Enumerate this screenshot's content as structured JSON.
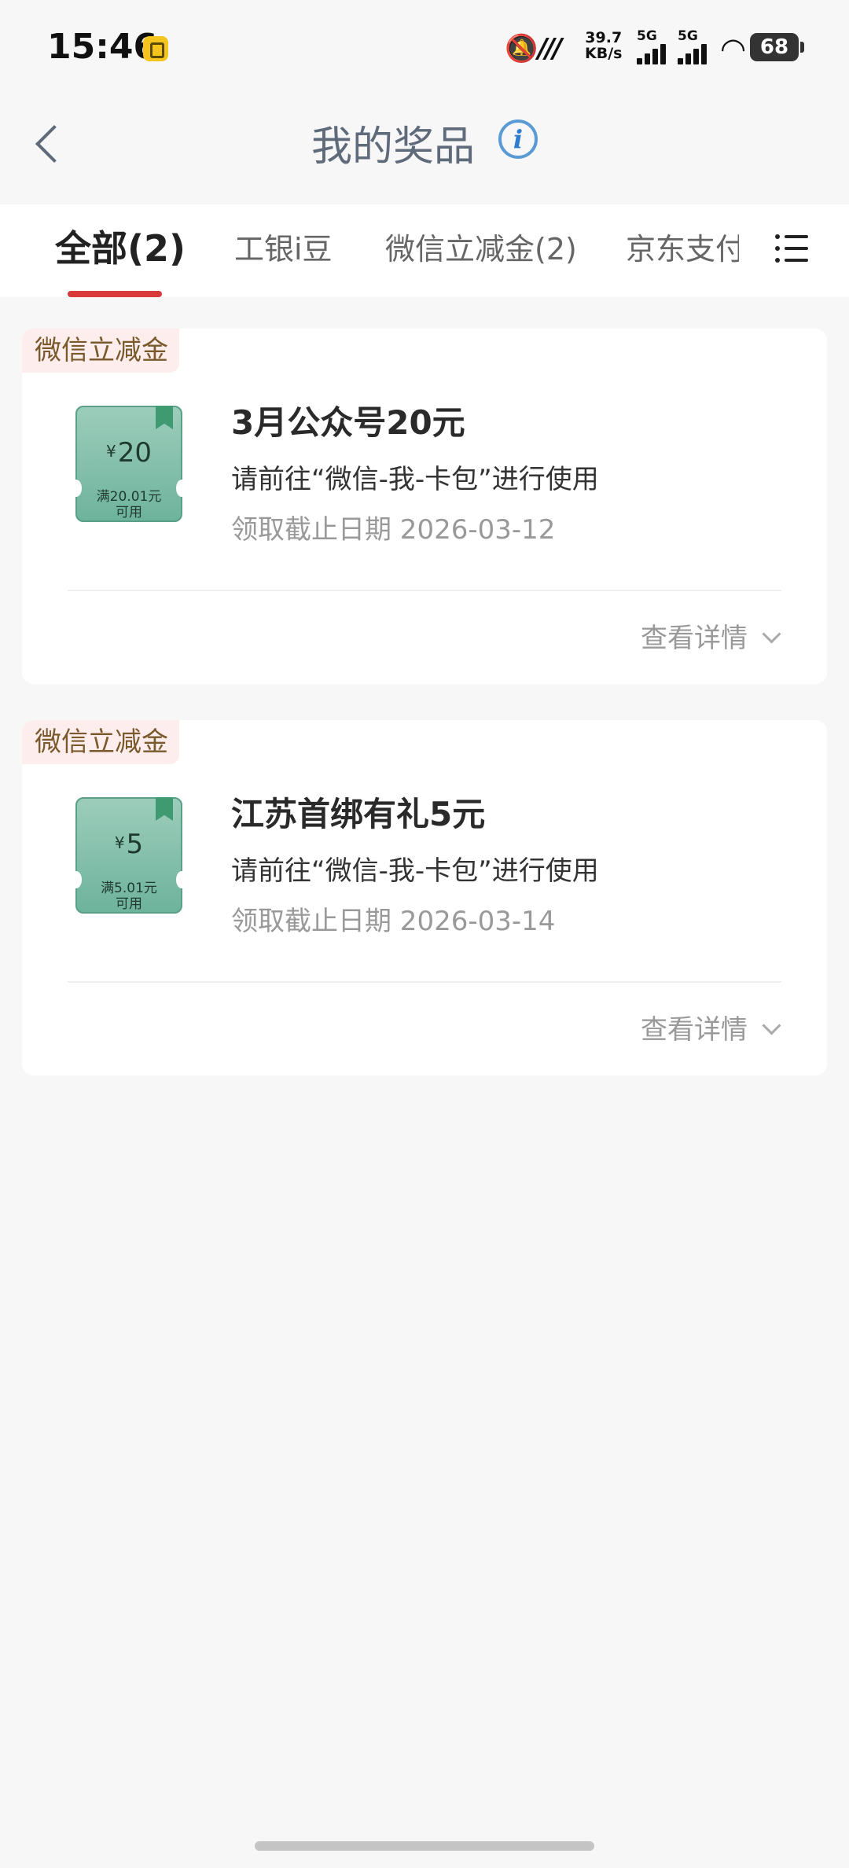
{
  "status_bar": {
    "time": "15:46",
    "net_speed_value": "39.7",
    "net_speed_unit": "KB/s",
    "signal_1_label": "5G",
    "signal_2_label": "5G",
    "battery": "68"
  },
  "header": {
    "title": "我的奖品"
  },
  "tabs": [
    {
      "label": "全部(2)",
      "active": true
    },
    {
      "label": "工银i豆",
      "active": false
    },
    {
      "label": "微信立减金(2)",
      "active": false
    },
    {
      "label": "京东支付",
      "active": false
    }
  ],
  "prizes": [
    {
      "tag": "微信立减金",
      "coupon_currency": "¥",
      "coupon_amount": "20",
      "coupon_condition_line1": "满20.01元",
      "coupon_condition_line2": "可用",
      "title": "3月公众号20元",
      "description": "请前往“微信-我-卡包”进行使用",
      "deadline": "领取截止日期 2026-03-12",
      "detail_label": "查看详情"
    },
    {
      "tag": "微信立减金",
      "coupon_currency": "¥",
      "coupon_amount": "5",
      "coupon_condition_line1": "满5.01元",
      "coupon_condition_line2": "可用",
      "title": "江苏首绑有礼5元",
      "description": "请前往“微信-我-卡包”进行使用",
      "deadline": "领取截止日期 2026-03-14",
      "detail_label": "查看详情"
    }
  ],
  "colors": {
    "accent": "#d83a3a",
    "tag_bg": "#fdeeed",
    "coupon_green": "#6eb39c"
  }
}
